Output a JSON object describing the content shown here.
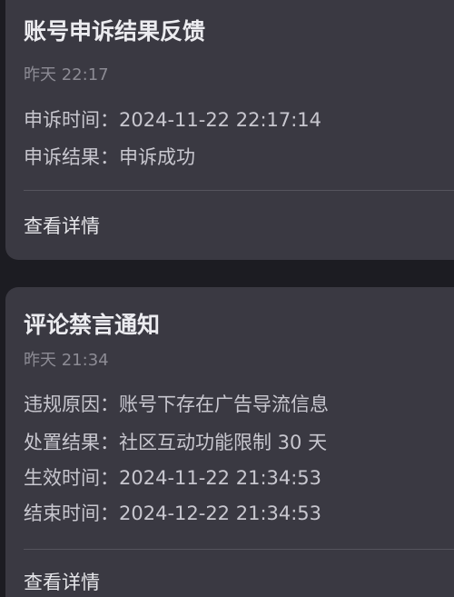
{
  "cards": [
    {
      "title": "账号申诉结果反馈",
      "time": "昨天 22:17",
      "rows": [
        {
          "label": "申诉时间：",
          "value": "2024-11-22 22:17:14"
        },
        {
          "label": "申诉结果：",
          "value": "申诉成功"
        }
      ],
      "action": "查看详情"
    },
    {
      "title": "评论禁言通知",
      "time": "昨天 21:34",
      "rows": [
        {
          "label": "违规原因：",
          "value": "账号下存在广告导流信息"
        },
        {
          "label": "处置结果：",
          "value": "社区互动功能限制 30 天"
        },
        {
          "label": "生效时间：",
          "value": "2024-11-22 21:34:53"
        },
        {
          "label": "结束时间：",
          "value": "2024-12-22 21:34:53"
        }
      ],
      "action": "查看详情"
    }
  ]
}
